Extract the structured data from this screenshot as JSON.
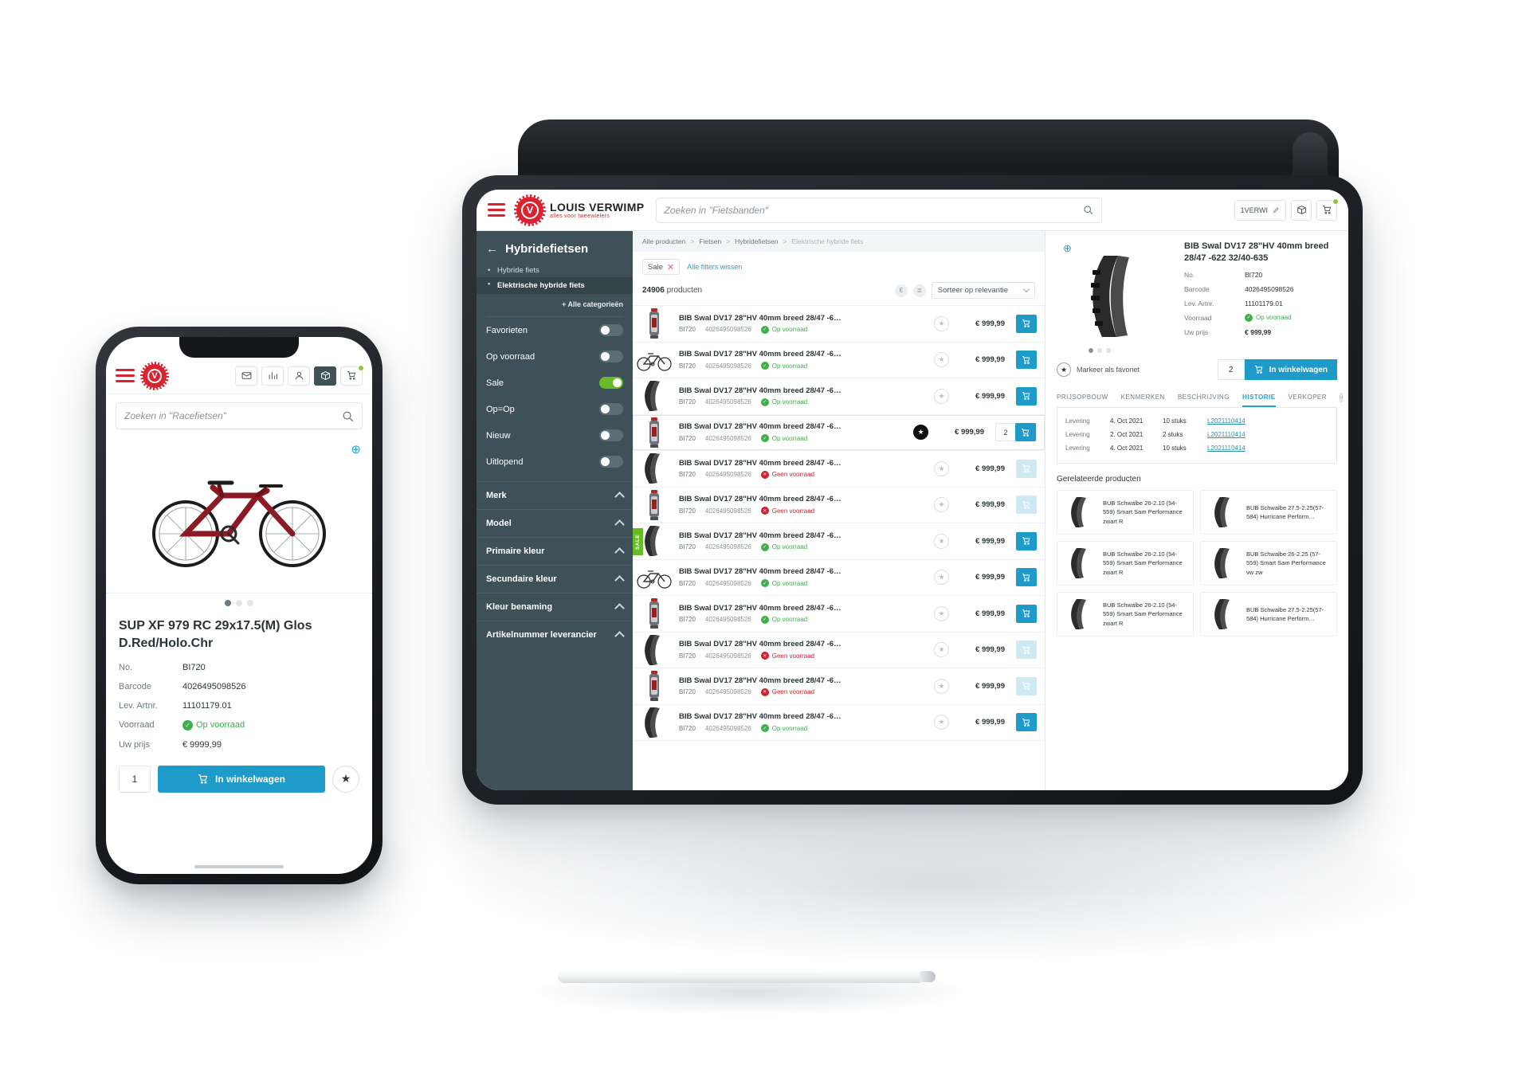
{
  "brand": {
    "name": "LOUIS VERWIMP",
    "tagline": "alles voor tweewielers",
    "monogram": "V"
  },
  "tablet": {
    "topbar": {
      "search_placeholder": "Zoeken in \"Fietsbanden\"",
      "user_chip": "1VERWI",
      "icons": {
        "hamburger": "hamburger-icon",
        "search": "search-icon",
        "edit": "pencil-edit-icon",
        "package": "package-icon",
        "cart": "cart-icon"
      }
    },
    "sidebar": {
      "back_icon": "arrow-left-icon",
      "title": "Hybridefietsen",
      "categories": [
        {
          "label": "Hybride fiets",
          "active": false
        },
        {
          "label": "Elektrische hybride fiets",
          "active": true
        }
      ],
      "all_categories": "+ Alle categorieën",
      "toggles": [
        {
          "label": "Favorieten",
          "on": false
        },
        {
          "label": "Op voorraad",
          "on": false
        },
        {
          "label": "Sale",
          "on": true
        },
        {
          "label": "Op=Op",
          "on": false
        },
        {
          "label": "Nieuw",
          "on": false
        },
        {
          "label": "Uitlopend",
          "on": false
        }
      ],
      "accordions": [
        {
          "label": "Merk"
        },
        {
          "label": "Model"
        },
        {
          "label": "Primaire kleur"
        },
        {
          "label": "Secundaire kleur"
        },
        {
          "label": "Kleur benaming"
        },
        {
          "label": "Artikelnummer leverancier"
        }
      ]
    },
    "breadcrumb": [
      "Alle producten",
      "Fietsen",
      "Hybridefietsen",
      "Elektrische hybride fiets"
    ],
    "filters": {
      "active_pill": "Sale",
      "clear_label": "Alle filters wissen"
    },
    "count": {
      "number": "24906",
      "label": "producten"
    },
    "sort": {
      "value": "Sorteer op relevantie",
      "price_icon": "euro-icon",
      "view_icon": "list-view-icon"
    },
    "products": [
      {
        "name": "BIB Swal DV17 28\"HV 40mm breed 28/47 -6…",
        "no": "BI720",
        "barcode": "4026495098526",
        "stock": "Op voorraad",
        "in_stock": true,
        "price": "€ 999,99",
        "fav": false,
        "qty": null,
        "sale": false,
        "img": "pump"
      },
      {
        "name": "BIB Swal DV17 28\"HV 40mm breed 28/47 -6…",
        "no": "BI720",
        "barcode": "4026495098526",
        "stock": "Op voorraad",
        "in_stock": true,
        "price": "€ 999,99",
        "fav": false,
        "qty": null,
        "sale": false,
        "img": "bike"
      },
      {
        "name": "BIB Swal DV17 28\"HV 40mm breed 28/47 -6…",
        "no": "BI720",
        "barcode": "4026495098526",
        "stock": "Op voorraad",
        "in_stock": true,
        "price": "€ 999,99",
        "fav": false,
        "qty": null,
        "sale": false,
        "img": "tire"
      },
      {
        "name": "BIB Swal DV17 28\"HV 40mm breed 28/47 -6…",
        "no": "BI720",
        "barcode": "4026495098526",
        "stock": "Op voorraad",
        "in_stock": true,
        "price": "€ 999,99",
        "fav": true,
        "qty": "2",
        "sale": false,
        "img": "pump"
      },
      {
        "name": "BIB Swal DV17 28\"HV 40mm breed 28/47 -6…",
        "no": "BI720",
        "barcode": "4026495098526",
        "stock": "Geen voorraad",
        "in_stock": false,
        "price": "€ 999,99",
        "fav": false,
        "qty": null,
        "sale": false,
        "img": "tire"
      },
      {
        "name": "BIB Swal DV17 28\"HV 40mm breed 28/47 -6…",
        "no": "BI720",
        "barcode": "4026495098526",
        "stock": "Geen voorraad",
        "in_stock": false,
        "price": "€ 999,99",
        "fav": false,
        "qty": null,
        "sale": false,
        "img": "pump"
      },
      {
        "name": "BIB Swal DV17 28\"HV 40mm breed 28/47 -6…",
        "no": "BI720",
        "barcode": "4026495098526",
        "stock": "Op voorraad",
        "in_stock": true,
        "price": "€ 999,99",
        "fav": false,
        "qty": null,
        "sale": true,
        "sale_label": "SALE",
        "img": "tire"
      },
      {
        "name": "BIB Swal DV17 28\"HV 40mm breed 28/47 -6…",
        "no": "BI720",
        "barcode": "4026495098526",
        "stock": "Op voorraad",
        "in_stock": true,
        "price": "€ 999,99",
        "fav": false,
        "qty": null,
        "sale": false,
        "img": "bike"
      },
      {
        "name": "BIB Swal DV17 28\"HV 40mm breed 28/47 -6…",
        "no": "BI720",
        "barcode": "4026495098526",
        "stock": "Op voorraad",
        "in_stock": true,
        "price": "€ 999,99",
        "fav": false,
        "qty": null,
        "sale": false,
        "img": "pump"
      },
      {
        "name": "BIB Swal DV17 28\"HV 40mm breed 28/47 -6…",
        "no": "BI720",
        "barcode": "4026495098526",
        "stock": "Geen voorraad",
        "in_stock": false,
        "price": "€ 999,99",
        "fav": false,
        "qty": null,
        "sale": false,
        "img": "tire"
      },
      {
        "name": "BIB Swal DV17 28\"HV 40mm breed 28/47 -6…",
        "no": "BI720",
        "barcode": "4026495098526",
        "stock": "Geen voorraad",
        "in_stock": false,
        "price": "€ 999,99",
        "fav": false,
        "qty": null,
        "sale": false,
        "img": "pump"
      },
      {
        "name": "BIB Swal DV17 28\"HV 40mm breed 28/47 -6…",
        "no": "BI720",
        "barcode": "4026495098526",
        "stock": "Op voorraad",
        "in_stock": true,
        "price": "€ 999,99",
        "fav": false,
        "qty": null,
        "sale": false,
        "img": "tire"
      }
    ],
    "detail": {
      "title": "BIB Swal DV17 28\"HV 40mm breed 28/47 -622 32/40-635",
      "zoom_icon": "zoom-in-icon",
      "specs": [
        {
          "key": "No.",
          "value": "BI720"
        },
        {
          "key": "Barcode",
          "value": "4026495098526"
        },
        {
          "key": "Lev. Artnr.",
          "value": "11101179.01"
        },
        {
          "key": "Voorraad",
          "value": "Op voorraad"
        },
        {
          "key": "Uw prijs",
          "value": "€ 999,99"
        }
      ],
      "favorite_label": "Markeer als favoriet",
      "quantity": "2",
      "add_to_cart": "In winkelwagen",
      "tabs": [
        {
          "label": "PRIJSOPBOUW",
          "active": false
        },
        {
          "label": "KENMERKEN",
          "active": false
        },
        {
          "label": "BESCHRIJVING",
          "active": false
        },
        {
          "label": "HISTORIE",
          "active": true
        },
        {
          "label": "VERKOPER",
          "active": false
        }
      ],
      "history": [
        {
          "type": "Levering",
          "date": "4. Oct 2021",
          "qty": "10 stuks",
          "ref": "L2021110414"
        },
        {
          "type": "Levering",
          "date": "2. Oct 2021",
          "qty": "2 stuks",
          "ref": "L2021110414"
        },
        {
          "type": "Levering",
          "date": "4. Oct 2021",
          "qty": "10 stuks",
          "ref": "L2021110414"
        }
      ],
      "related_title": "Gerelateerde producten",
      "related": [
        {
          "name": "BUB Schwalbe 26-2.10 (54-559) Smart Sam Performance zwart R"
        },
        {
          "name": "BUB Schwalbe 27.5-2.25(57-584) Hurricane Perform…"
        },
        {
          "name": "BUB Schwalbe 26-2.10 (54-559) Smart Sam Performance zwart R"
        },
        {
          "name": "BUB Schwalbe 26-2.25 (57-559) Smart Sam Performance vw zw"
        },
        {
          "name": "BUB Schwalbe 26-2.10 (54-559) Smart Sam Performance zwart R"
        },
        {
          "name": "BUB Schwalbe 27.5-2.25(57-584) Hurricane Perform…"
        }
      ]
    }
  },
  "phone": {
    "status": {
      "left": "",
      "right": ""
    },
    "topbar_icons": {
      "hamburger": "hamburger-icon",
      "mail": "mail-icon",
      "chart": "bar-chart-icon",
      "user": "user-icon",
      "package": "package-icon",
      "cart": "cart-icon"
    },
    "search_placeholder": "Zoeken in \"Racefietsen\"",
    "zoom_icon": "zoom-in-icon",
    "title": "SUP XF 979 RC 29x17.5(M) Glos D.Red/Holo.Chr",
    "specs": [
      {
        "key": "No.",
        "value": "BI720"
      },
      {
        "key": "Barcode",
        "value": "4026495098526"
      },
      {
        "key": "Lev. Artnr.",
        "value": "11101179.01"
      },
      {
        "key": "Voorraad",
        "value": "Op voorraad"
      },
      {
        "key": "Uw prijs",
        "value": "€ 9999,99"
      }
    ],
    "quantity": "1",
    "add_to_cart": "In winkelwagen",
    "favorite_icon": "star-icon"
  },
  "colors": {
    "accent": "#1f9bc9",
    "brand_red": "#d9232e",
    "sidebar": "#3e5058",
    "green": "#67bb29",
    "stock_in": "#3db049",
    "stock_out": "#d0202f"
  }
}
